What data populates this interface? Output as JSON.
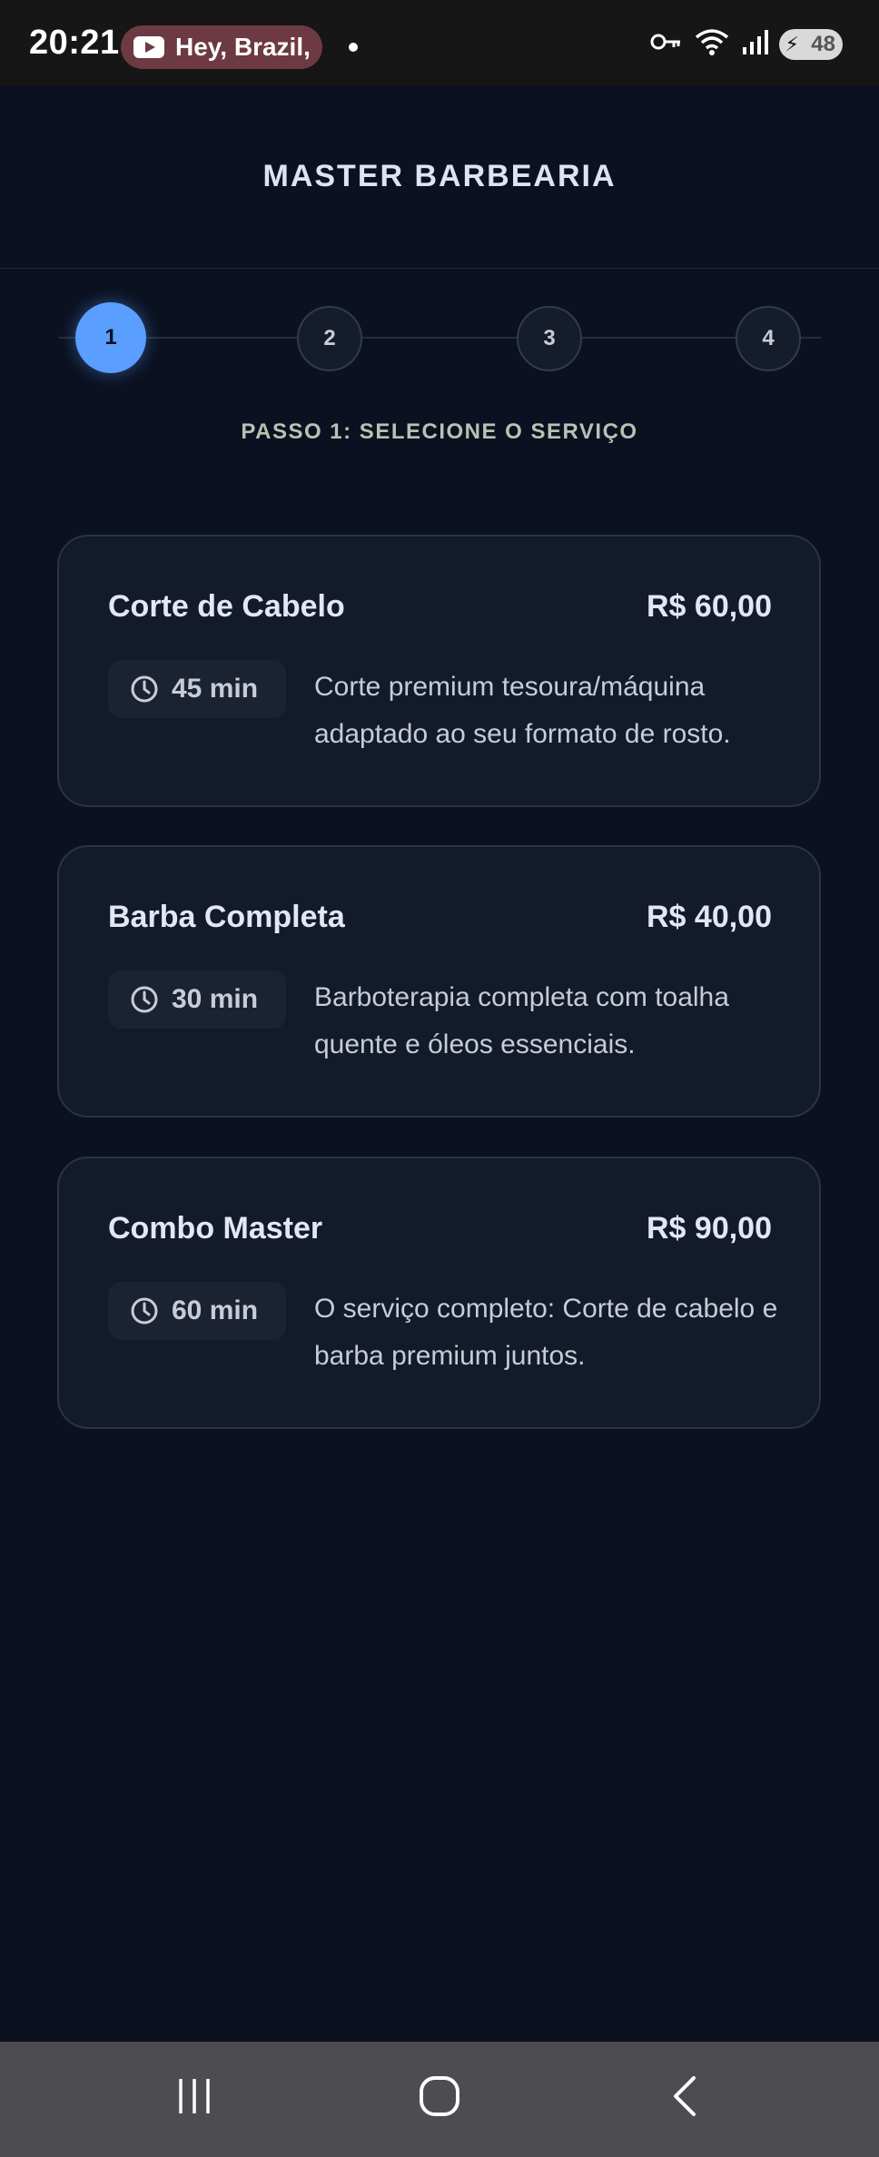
{
  "status_bar": {
    "time": "20:21",
    "media_text": "Hey, Brazil,",
    "battery": "48"
  },
  "header": {
    "title": "MASTER BARBEARIA"
  },
  "stepper": {
    "steps": [
      "1",
      "2",
      "3",
      "4"
    ],
    "active_step": 1,
    "label": "PASSO 1: SELECIONE O SERVIÇO"
  },
  "services": [
    {
      "name": "Corte de Cabelo",
      "price": "R$ 60,00",
      "duration": "45 min",
      "description": "Corte premium tesoura/máquina adaptado ao seu formato de rosto."
    },
    {
      "name": "Barba Completa",
      "price": "R$ 40,00",
      "duration": "30 min",
      "description": "Barboterapia completa com toalha quente e óleos essenciais."
    },
    {
      "name": "Combo Master",
      "price": "R$ 90,00",
      "duration": "60 min",
      "description": "O serviço completo: Corte de cabelo e barba premium juntos."
    }
  ],
  "colors": {
    "background": "#0b1120",
    "card": "#131a29",
    "accent": "#5a9eff",
    "nav_bar": "#4d4c51"
  },
  "icons": {
    "status_right": [
      "key-icon",
      "wifi-icon",
      "signal-icon",
      "battery-icon"
    ],
    "duration": "clock-icon",
    "nav": [
      "recent-apps-icon",
      "home-icon",
      "back-icon"
    ]
  }
}
